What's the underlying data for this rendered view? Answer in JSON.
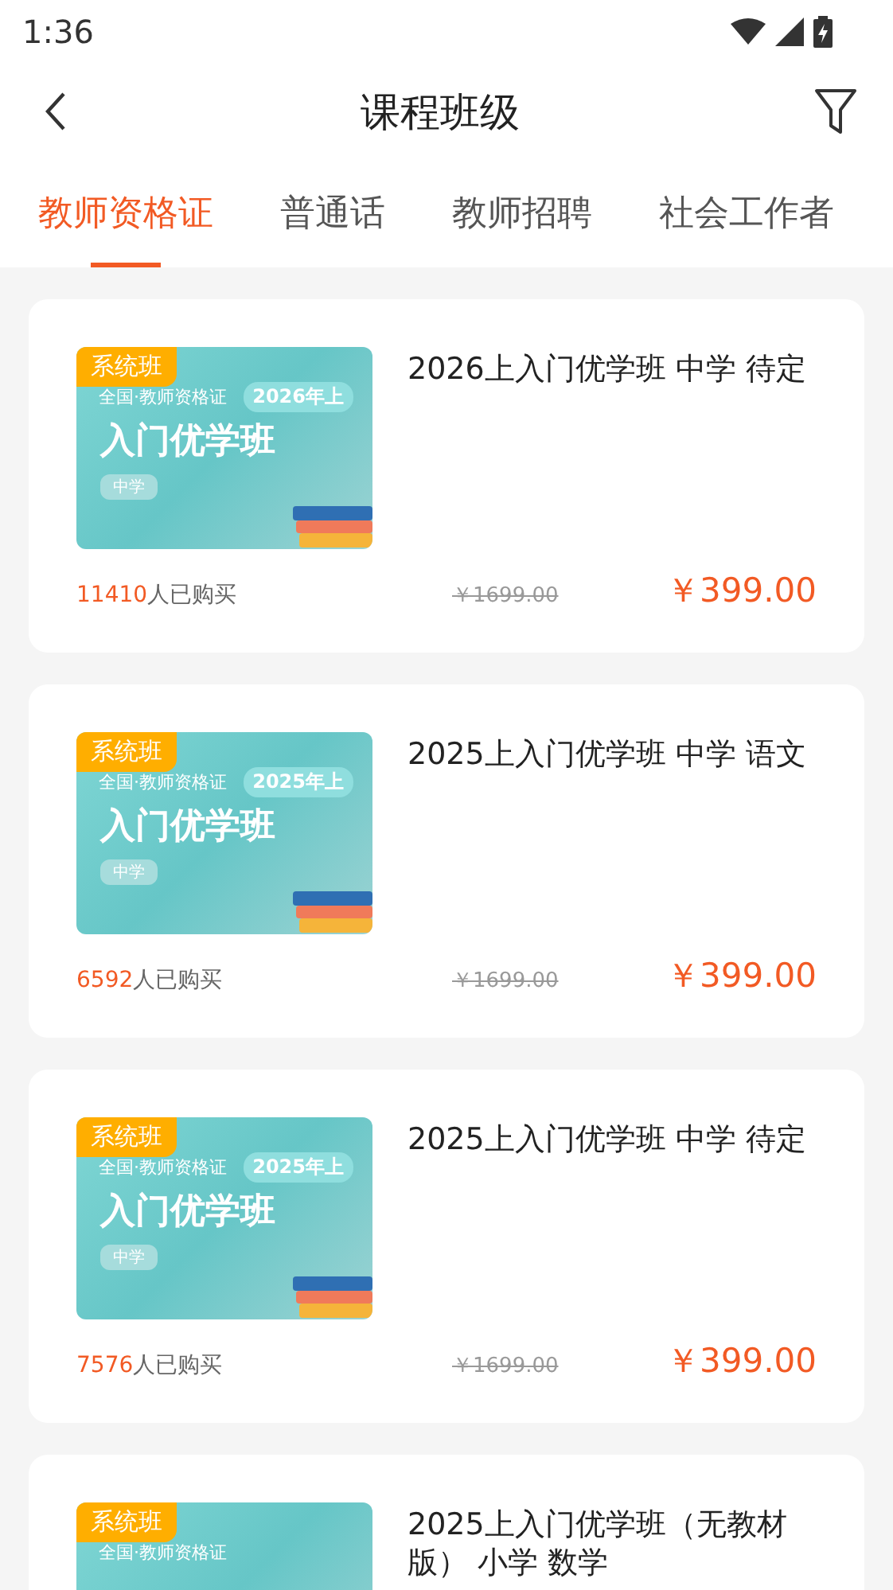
{
  "status_bar": {
    "time": "1:36"
  },
  "header": {
    "title": "课程班级"
  },
  "tabs": [
    {
      "label": "教师资格证",
      "selected": true
    },
    {
      "label": "普通话",
      "selected": false
    },
    {
      "label": "教师招聘",
      "selected": false
    },
    {
      "label": "社会工作者",
      "selected": false
    }
  ],
  "courses": [
    {
      "badge": "系统班",
      "cover": {
        "subtitle": "全国·教师资格证",
        "year": "2026年上",
        "title": "入门优学班",
        "level": "中学"
      },
      "title": "2026上入门优学班 中学 待定",
      "buyers": "11410",
      "buyers_suffix": "人已购买",
      "original_price": "￥1699.00",
      "price": "￥399.00"
    },
    {
      "badge": "系统班",
      "cover": {
        "subtitle": "全国·教师资格证",
        "year": "2025年上",
        "title": "入门优学班",
        "level": "中学"
      },
      "title": "2025上入门优学班 中学 语文",
      "buyers": "6592",
      "buyers_suffix": "人已购买",
      "original_price": "￥1699.00",
      "price": "￥399.00"
    },
    {
      "badge": "系统班",
      "cover": {
        "subtitle": "全国·教师资格证",
        "year": "2025年上",
        "title": "入门优学班",
        "level": "中学"
      },
      "title": "2025上入门优学班 中学 待定",
      "buyers": "7576",
      "buyers_suffix": "人已购买",
      "original_price": "￥1699.00",
      "price": "￥399.00"
    },
    {
      "badge": "系统班",
      "cover": {
        "subtitle": "全国·教师资格证"
      },
      "title": "2025上入门优学班（无教材版） 小学 数学"
    }
  ]
}
